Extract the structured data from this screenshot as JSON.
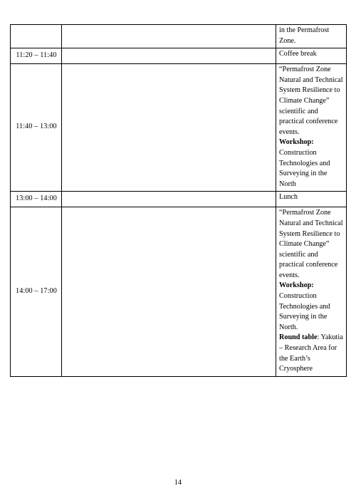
{
  "document": {
    "page_number": "14"
  },
  "table": {
    "columns": [
      "time",
      "middle",
      "description"
    ],
    "rows": [
      {
        "time": "",
        "middle": "",
        "description_parts": [
          {
            "text": "in the Permafrost Zone.",
            "bold": false
          }
        ],
        "description_plain": "in the Permafrost Zone."
      },
      {
        "time": "11:20 – 11:40",
        "middle": "",
        "description_parts": [
          {
            "text": "Coffee break",
            "bold": false
          }
        ],
        "description_plain": "Coffee break"
      },
      {
        "time": "11:40 – 13:00",
        "middle": "",
        "description_parts": [
          {
            "text": "“Permafrost Zone Natural and Technical System Resilience to Climate Change” scientific and practical conference events.",
            "bold": false
          },
          {
            "text": "Workshop:",
            "bold": true
          },
          {
            "text": " Construction Technologies and Surveying in the North",
            "bold": false
          }
        ],
        "description_plain": "“Permafrost Zone Natural and Technical System Resilience to Climate Change” scientific and practical conference events. Workshop: Construction Technologies and Surveying in the North"
      },
      {
        "time": "13:00 – 14:00",
        "middle": "",
        "description_parts": [
          {
            "text": "Lunch",
            "bold": false
          }
        ],
        "description_plain": "Lunch"
      },
      {
        "time": "14:00 – 17:00",
        "middle": "",
        "description_parts": [
          {
            "text": "“Permafrost Zone Natural and Technical System Resilience to Climate Change” scientific and practical conference events.",
            "bold": false
          },
          {
            "text": "Workshop:",
            "bold": true
          },
          {
            "text": " Construction Technologies and Surveying in the North.",
            "bold": false
          },
          {
            "text": "Round table",
            "bold": true
          },
          {
            "text": ": Yakutia – Research Area for the Earth’s Cryosphere",
            "bold": false
          }
        ],
        "description_plain": "“Permafrost Zone Natural and Technical System Resilience to Climate Change” scientific and practical conference events. Workshop: Construction Technologies and Surveying in the North. Round table: Yakutia – Research Area for the Earth’s Cryosphere"
      }
    ]
  }
}
